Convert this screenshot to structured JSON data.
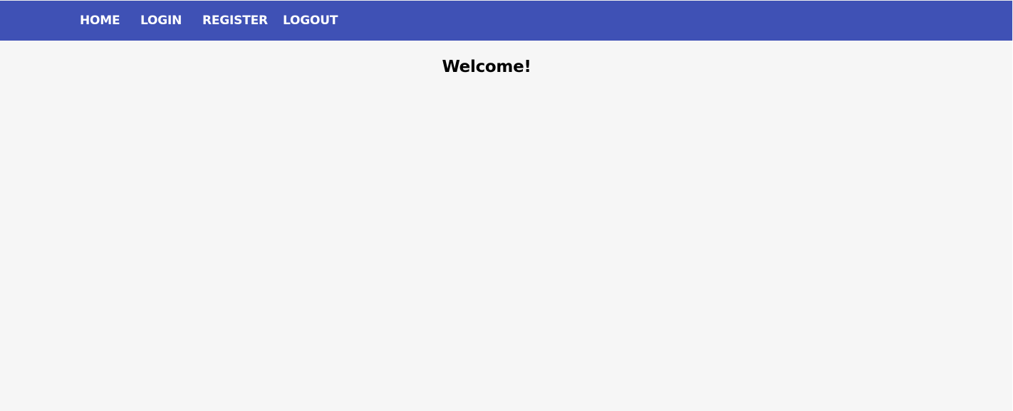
{
  "nav": {
    "items": [
      {
        "label": "HOME"
      },
      {
        "label": "LOGIN"
      },
      {
        "label": "REGISTER"
      },
      {
        "label": "LOGOUT"
      }
    ]
  },
  "main": {
    "heading": "Welcome!"
  },
  "colors": {
    "navbar": "#3f51b5",
    "background": "#f6f6f6",
    "nav_text": "#ffffff",
    "heading_text": "#000000"
  }
}
